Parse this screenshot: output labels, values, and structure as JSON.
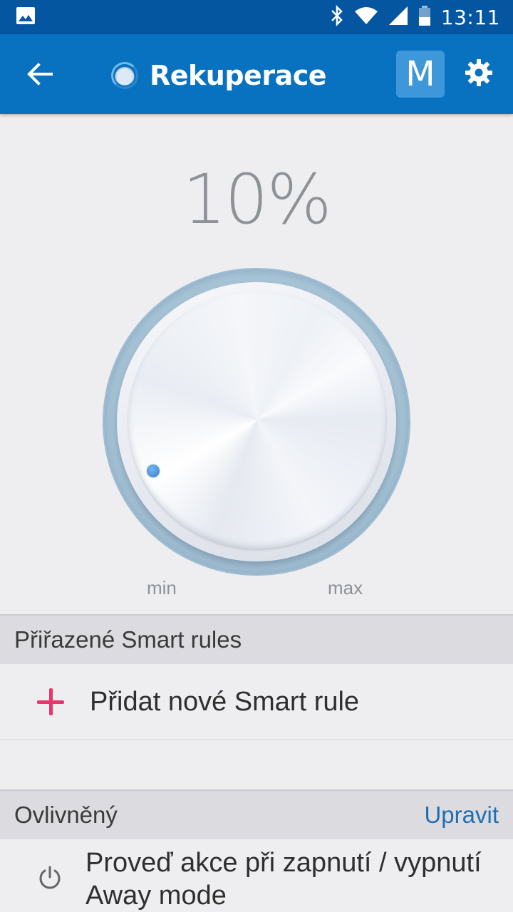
{
  "status_bar": {
    "time": "13:11",
    "icons": [
      "image-icon",
      "bluetooth-icon",
      "wifi-icon",
      "signal-icon",
      "battery-icon"
    ]
  },
  "app_bar": {
    "title": "Rekuperace",
    "mode_button_label": "M",
    "icons": [
      "back-arrow-icon",
      "device-status-icon",
      "gear-icon"
    ]
  },
  "dial": {
    "value_text": "10%",
    "level_percent": 10,
    "min_label": "min",
    "max_label": "max",
    "accent_color": "#3a8ad8"
  },
  "smart_rules": {
    "header": "Přiřazené Smart rules",
    "add_label": "Přidat nové Smart rule",
    "add_icon_color": "#e8356c"
  },
  "affected": {
    "header": "Ovlivněný",
    "edit_label": "Upravit",
    "item_label": "Proveď akce při zapnutí / vypnutí Away mode"
  },
  "colors": {
    "status_bar": "#0556a1",
    "app_bar": "#0872c1",
    "background": "#eeeef1"
  }
}
